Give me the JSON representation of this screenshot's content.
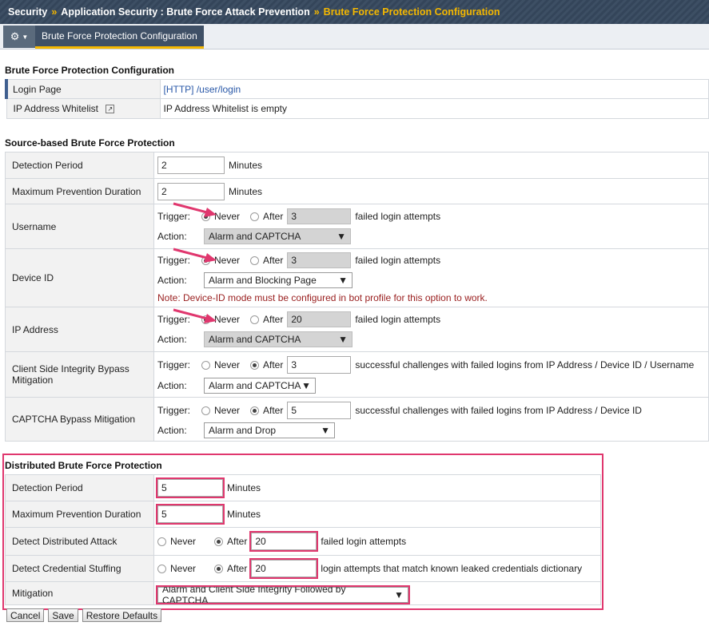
{
  "breadcrumb": {
    "part1": "Security",
    "sep": "»",
    "part2": "Application Security : Brute Force Attack Prevention",
    "current": "Brute Force Protection Configuration"
  },
  "tab": {
    "label": "Brute Force Protection Configuration"
  },
  "config": {
    "title": "Brute Force Protection Configuration",
    "login_page_label": "Login Page",
    "login_page_value": "[HTTP] /user/login",
    "whitelist_label": "IP Address Whitelist",
    "whitelist_value": "IP Address Whitelist is empty"
  },
  "source": {
    "title": "Source-based Brute Force Protection",
    "detection_period": {
      "label": "Detection Period",
      "value": "2",
      "unit": "Minutes"
    },
    "max_prevention": {
      "label": "Maximum Prevention Duration",
      "value": "2",
      "unit": "Minutes"
    },
    "username": {
      "label": "Username",
      "trigger_label": "Trigger:",
      "never": "Never",
      "after": "After",
      "after_value": "3",
      "suffix": "failed login attempts",
      "action_label": "Action:",
      "action_value": "Alarm and CAPTCHA"
    },
    "device_id": {
      "label": "Device ID",
      "trigger_label": "Trigger:",
      "never": "Never",
      "after": "After",
      "after_value": "3",
      "suffix": "failed login attempts",
      "action_label": "Action:",
      "action_value": "Alarm and Blocking Page",
      "note": "Note: Device-ID mode must be configured in bot profile for this option to work."
    },
    "ip_address": {
      "label": "IP Address",
      "trigger_label": "Trigger:",
      "never": "Never",
      "after": "After",
      "after_value": "20",
      "suffix": "failed login attempts",
      "action_label": "Action:",
      "action_value": "Alarm and CAPTCHA"
    },
    "csi_bypass": {
      "label": "Client Side Integrity Bypass Mitigation",
      "trigger_label": "Trigger:",
      "never": "Never",
      "after": "After",
      "after_value": "3",
      "suffix": "successful challenges with failed logins from IP Address / Device ID / Username",
      "action_label": "Action:",
      "action_value": "Alarm and CAPTCHA"
    },
    "captcha_bypass": {
      "label": "CAPTCHA Bypass Mitigation",
      "trigger_label": "Trigger:",
      "never": "Never",
      "after": "After",
      "after_value": "5",
      "suffix": "successful challenges with failed logins from IP Address / Device ID",
      "action_label": "Action:",
      "action_value": "Alarm and Drop"
    }
  },
  "distributed": {
    "title": "Distributed Brute Force Protection",
    "detection_period": {
      "label": "Detection Period",
      "value": "5",
      "unit": "Minutes"
    },
    "max_prevention": {
      "label": "Maximum Prevention Duration",
      "value": "5",
      "unit": "Minutes"
    },
    "detect_attack": {
      "label": "Detect Distributed Attack",
      "never": "Never",
      "after": "After",
      "value": "20",
      "suffix": "failed login attempts"
    },
    "credential_stuffing": {
      "label": "Detect Credential Stuffing",
      "never": "Never",
      "after": "After",
      "value": "20",
      "suffix": "login attempts that match known leaked credentials dictionary"
    },
    "mitigation": {
      "label": "Mitigation",
      "value": "Alarm and Client Side Integrity Followed by CAPTCHA"
    }
  },
  "buttons": {
    "cancel": "Cancel",
    "save": "Save",
    "restore": "Restore Defaults"
  },
  "colors": {
    "accent": "#f5b800",
    "highlight": "#e0376e",
    "header_bg": "#3d4f64"
  },
  "icons": {
    "gear": "gear-icon",
    "external": "external-link-icon",
    "arrow": "pointer-arrow-icon"
  }
}
